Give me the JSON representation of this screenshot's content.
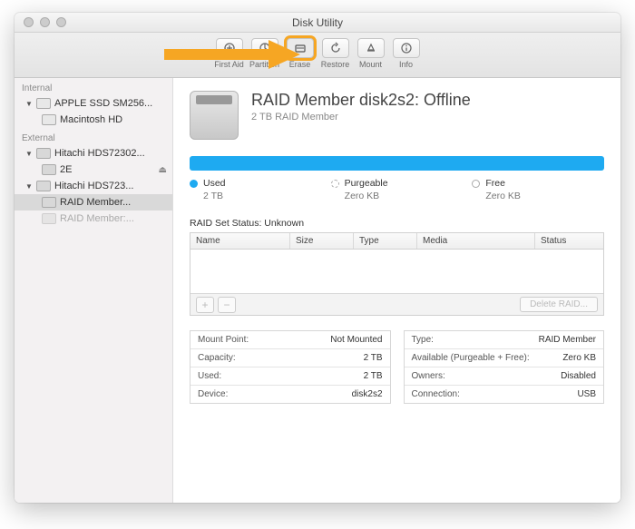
{
  "window": {
    "title": "Disk Utility"
  },
  "toolbar": {
    "first_aid": "First Aid",
    "partition": "Partition",
    "erase": "Erase",
    "restore": "Restore",
    "mount": "Mount",
    "info": "Info"
  },
  "sidebar": {
    "internal_label": "Internal",
    "external_label": "External",
    "internal": [
      {
        "name": "APPLE SSD SM256..."
      },
      {
        "name": "Macintosh HD"
      }
    ],
    "external": [
      {
        "name": "Hitachi HDS72302..."
      },
      {
        "name": "2E"
      },
      {
        "name": "Hitachi HDS723..."
      },
      {
        "name": "RAID Member..."
      },
      {
        "name": "RAID Member:..."
      }
    ]
  },
  "main": {
    "title": "RAID Member disk2s2: Offline",
    "subtitle": "2 TB RAID Member",
    "legend": {
      "used_label": "Used",
      "used_val": "2 TB",
      "purge_label": "Purgeable",
      "purge_val": "Zero KB",
      "free_label": "Free",
      "free_val": "Zero KB"
    },
    "raid_status": "RAID Set Status: Unknown",
    "columns": {
      "name": "Name",
      "size": "Size",
      "type": "Type",
      "media": "Media",
      "status": "Status"
    },
    "footer": {
      "delete": "Delete RAID..."
    },
    "info_left": {
      "mount_point_k": "Mount Point:",
      "mount_point_v": "Not Mounted",
      "capacity_k": "Capacity:",
      "capacity_v": "2 TB",
      "used_k": "Used:",
      "used_v": "2 TB",
      "device_k": "Device:",
      "device_v": "disk2s2"
    },
    "info_right": {
      "type_k": "Type:",
      "type_v": "RAID Member",
      "avail_k": "Available (Purgeable + Free):",
      "avail_v": "Zero KB",
      "owners_k": "Owners:",
      "owners_v": "Disabled",
      "conn_k": "Connection:",
      "conn_v": "USB"
    }
  }
}
